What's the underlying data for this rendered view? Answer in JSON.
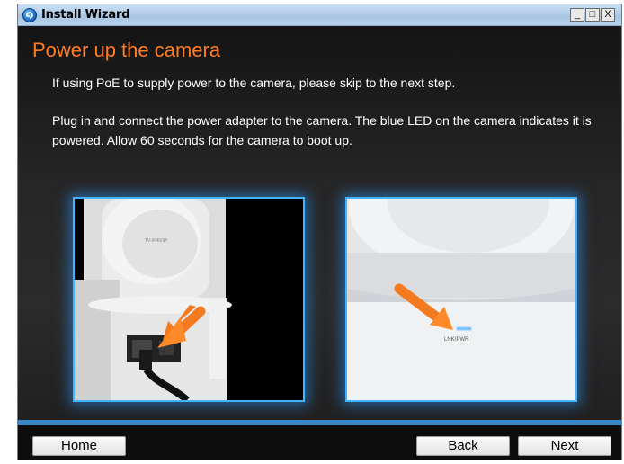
{
  "window": {
    "title": "Install Wizard",
    "controls": {
      "minimize": "_",
      "maximize": "□",
      "close": "X"
    }
  },
  "page": {
    "heading": "Power up the camera",
    "paragraph1": "If using PoE to supply power to the camera, please skip to the next step.",
    "paragraph2": "Plug in and connect the power adapter to the camera. The blue LED on the camera indicates it is powered. Allow 60 seconds for the camera to boot up."
  },
  "photos": {
    "left": {
      "label": "TV-IP450PI"
    },
    "right": {
      "label": "LNK/PWR"
    }
  },
  "footer": {
    "home_label": "Home",
    "back_label": "Back",
    "next_label": "Next"
  },
  "colors": {
    "heading": "#ff7a22",
    "accent_blue": "#3a86c9",
    "photo_border": "#45b4ff"
  }
}
